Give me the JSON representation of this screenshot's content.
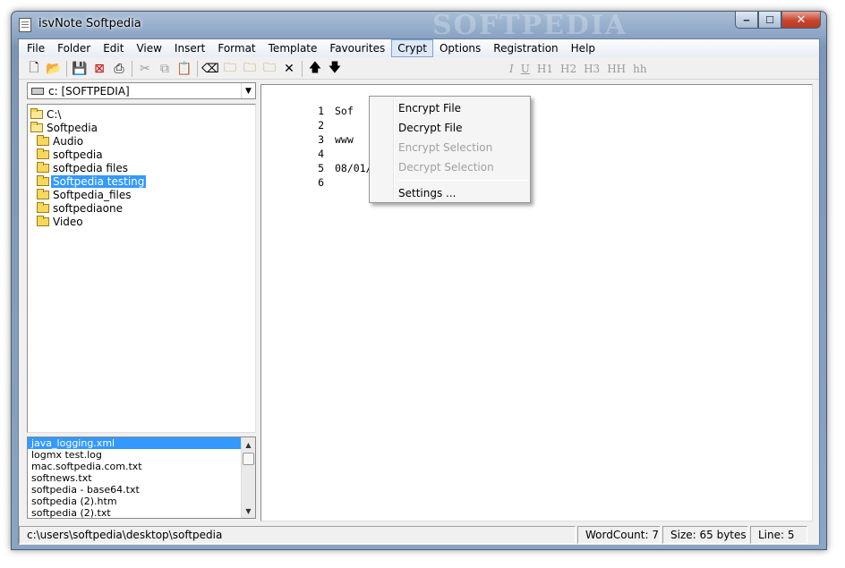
{
  "window": {
    "title": "isvNote  Softpedia",
    "watermark": "SOFTPEDIA",
    "controls": {
      "minimize": "‒",
      "maximize": "☐",
      "close": "✕"
    }
  },
  "menubar": {
    "items": [
      "File",
      "Folder",
      "Edit",
      "View",
      "Insert",
      "Format",
      "Template",
      "Favourites",
      "Crypt",
      "Options",
      "Registration",
      "Help"
    ],
    "open_item": "Crypt"
  },
  "toolbar": {
    "format_labels": [
      "I",
      "U",
      "H1",
      "H2",
      "H3",
      "HH",
      "hh"
    ]
  },
  "drive": {
    "selected": "c: [SOFTPEDIA]"
  },
  "folder_tree": [
    {
      "label": "C:\\",
      "level": 0,
      "open": true
    },
    {
      "label": "Softpedia",
      "level": 0,
      "open": true
    },
    {
      "label": "Audio",
      "level": 1
    },
    {
      "label": "softpedia",
      "level": 1
    },
    {
      "label": "softpedia files",
      "level": 1
    },
    {
      "label": "Softpedia testing",
      "level": 1,
      "selected": true
    },
    {
      "label": "Softpedia_files",
      "level": 1
    },
    {
      "label": "softpediaone",
      "level": 1
    },
    {
      "label": "Video",
      "level": 1
    }
  ],
  "file_list": [
    {
      "name": "java_logging.xml",
      "selected": true
    },
    {
      "name": "logmx test.log"
    },
    {
      "name": "mac.softpedia.com.txt"
    },
    {
      "name": "softnews.txt"
    },
    {
      "name": "softpedia - base64.txt"
    },
    {
      "name": "softpedia (2).htm"
    },
    {
      "name": "softpedia (2).txt"
    }
  ],
  "editor": {
    "lines": [
      {
        "num": "1",
        "text": "Sof"
      },
      {
        "num": "2",
        "text": ""
      },
      {
        "num": "3",
        "text": "www"
      },
      {
        "num": "4",
        "text": ""
      },
      {
        "num": "5",
        "text": "08/01/2013 2:46:55 PM"
      },
      {
        "num": "6",
        "text": ""
      }
    ]
  },
  "crypt_menu": {
    "items": [
      {
        "label": "Encrypt File",
        "enabled": true
      },
      {
        "label": "Decrypt File",
        "enabled": true
      },
      {
        "label": "Encrypt Selection",
        "enabled": false
      },
      {
        "label": "Decrypt Selection",
        "enabled": false
      },
      {
        "separator": true
      },
      {
        "label": "Settings ...",
        "enabled": true
      }
    ]
  },
  "status": {
    "path": "c:\\users\\softpedia\\desktop\\softpedia",
    "word_count": "WordCount: 7",
    "size": "Size: 65 bytes",
    "line": "Line: 5"
  },
  "colors": {
    "selection": "#3399ff",
    "menu_open_bg": "#dde8f7",
    "title_gradient_top": "#a9bed6"
  }
}
